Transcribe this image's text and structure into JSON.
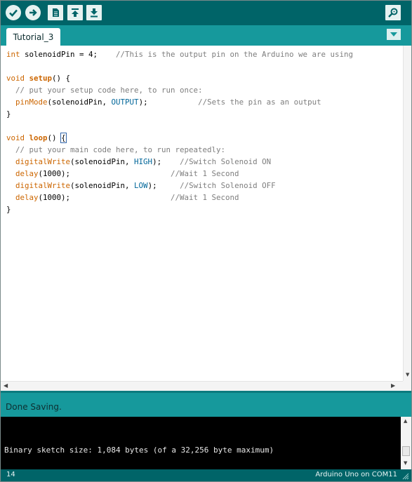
{
  "toolbar": {
    "buttons": [
      {
        "name": "verify",
        "icon": "checkmark-icon"
      },
      {
        "name": "upload",
        "icon": "right-arrow-icon"
      },
      {
        "name": "new",
        "icon": "new-file-icon"
      },
      {
        "name": "open",
        "icon": "open-up-arrow-icon"
      },
      {
        "name": "save",
        "icon": "save-down-arrow-icon"
      },
      {
        "name": "serial-monitor",
        "icon": "magnifier-icon"
      }
    ]
  },
  "tabs": [
    {
      "label": "Tutorial_3",
      "active": true
    }
  ],
  "editor": {
    "lines": [
      [
        {
          "t": "int",
          "c": "kw"
        },
        {
          "t": " solenoidPin = 4;    ",
          "c": ""
        },
        {
          "t": "//This is the output pin on the Arduino we are using",
          "c": "cm"
        }
      ],
      [],
      [
        {
          "t": "void",
          "c": "kw"
        },
        {
          "t": " ",
          "c": ""
        },
        {
          "t": "setup",
          "c": "kwb"
        },
        {
          "t": "() {",
          "c": ""
        }
      ],
      [
        {
          "t": "  ",
          "c": ""
        },
        {
          "t": "// put your setup code here, to run once:",
          "c": "cm"
        }
      ],
      [
        {
          "t": "  ",
          "c": ""
        },
        {
          "t": "pinMode",
          "c": "kw"
        },
        {
          "t": "(solenoidPin, ",
          "c": ""
        },
        {
          "t": "OUTPUT",
          "c": "cn"
        },
        {
          "t": ");           ",
          "c": ""
        },
        {
          "t": "//Sets the pin as an output",
          "c": "cm"
        }
      ],
      [
        {
          "t": "}",
          "c": ""
        }
      ],
      [],
      [
        {
          "t": "void",
          "c": "kw"
        },
        {
          "t": " ",
          "c": ""
        },
        {
          "t": "loop",
          "c": "kwb"
        },
        {
          "t": "() ",
          "c": ""
        },
        {
          "t": "{",
          "c": "brace-hl"
        }
      ],
      [
        {
          "t": "  ",
          "c": ""
        },
        {
          "t": "// put your main code here, to run repeatedly:",
          "c": "cm"
        }
      ],
      [
        {
          "t": "  ",
          "c": ""
        },
        {
          "t": "digitalWrite",
          "c": "kw"
        },
        {
          "t": "(solenoidPin, ",
          "c": ""
        },
        {
          "t": "HIGH",
          "c": "cn"
        },
        {
          "t": ");    ",
          "c": ""
        },
        {
          "t": "//Switch Solenoid ON",
          "c": "cm"
        }
      ],
      [
        {
          "t": "  ",
          "c": ""
        },
        {
          "t": "delay",
          "c": "kw"
        },
        {
          "t": "(1000);                      ",
          "c": ""
        },
        {
          "t": "//Wait 1 Second",
          "c": "cm"
        }
      ],
      [
        {
          "t": "  ",
          "c": ""
        },
        {
          "t": "digitalWrite",
          "c": "kw"
        },
        {
          "t": "(solenoidPin, ",
          "c": ""
        },
        {
          "t": "LOW",
          "c": "cn"
        },
        {
          "t": ");     ",
          "c": ""
        },
        {
          "t": "//Switch Solenoid OFF",
          "c": "cm"
        }
      ],
      [
        {
          "t": "  ",
          "c": ""
        },
        {
          "t": "delay",
          "c": "kw"
        },
        {
          "t": "(1000);                      ",
          "c": ""
        },
        {
          "t": "//Wait 1 Second",
          "c": "cm"
        }
      ],
      [
        {
          "t": "}",
          "c": ""
        }
      ]
    ]
  },
  "status": {
    "message": "Done Saving."
  },
  "console": {
    "output": "Binary sketch size: 1,084 bytes (of a 32,256 byte maximum)"
  },
  "footer": {
    "line_number": "14",
    "board": "Arduino Uno on COM11"
  },
  "colors": {
    "toolbar": "#006468",
    "tabbar": "#16999c",
    "keyword": "#cc6600",
    "comment": "#7e7e7e",
    "constant": "#006699"
  }
}
